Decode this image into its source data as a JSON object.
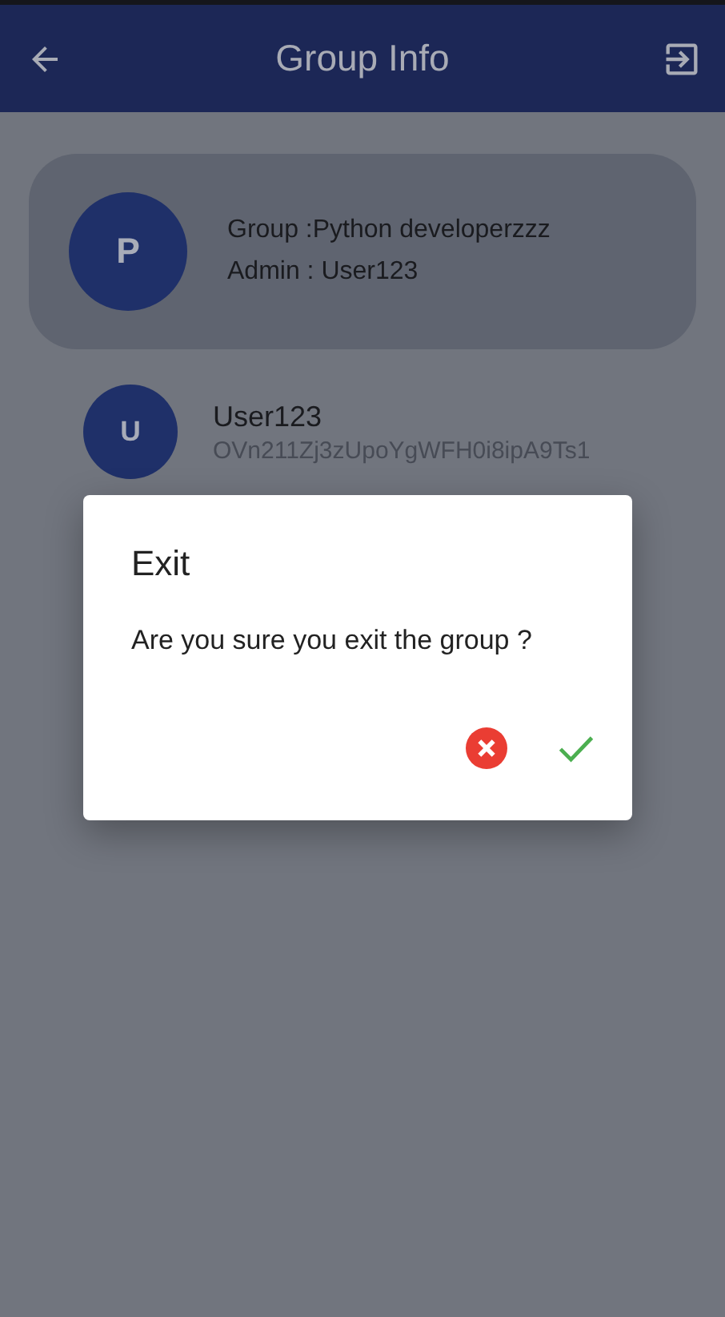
{
  "app_bar": {
    "title": "Group Info"
  },
  "group": {
    "avatar": "P",
    "name": "Group :Python developerzzz",
    "admin": "Admin : User123"
  },
  "members": [
    {
      "avatar": "U",
      "name": "User123",
      "id": "OVn211Zj3zUpoYgWFH0i8ipA9Ts1"
    }
  ],
  "dialog": {
    "title": "Exit",
    "message": "Are you sure you exit the group ?"
  }
}
